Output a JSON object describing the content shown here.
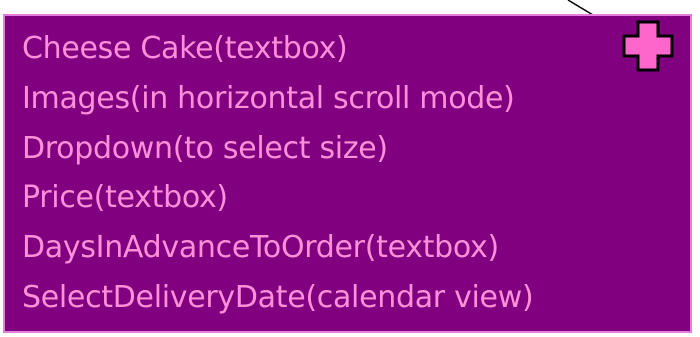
{
  "colors": {
    "box_fill": "#800080",
    "box_border": "#e47de0",
    "text": "#ff8fd9",
    "plus_fill": "#ff66cc",
    "plus_outline": "#000000"
  },
  "card": {
    "lines": [
      "Cheese Cake(textbox)",
      "Images(in horizontal scroll mode)",
      "Dropdown(to select size)",
      "Price(textbox)",
      "DaysInAdvanceToOrder(textbox)",
      "SelectDeliveryDate(calendar view)"
    ],
    "add_icon": "plus-icon"
  }
}
